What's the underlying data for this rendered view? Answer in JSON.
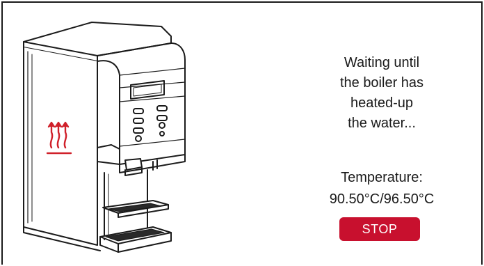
{
  "status": {
    "lines": [
      "Waiting until",
      "the boiler has",
      "heated-up",
      "the water..."
    ]
  },
  "temperature": {
    "label": "Temperature:",
    "current": "90.50°C",
    "target": "96.50°C",
    "display": "90.50°C/96.50°C"
  },
  "actions": {
    "stop_label": "STOP"
  },
  "colors": {
    "accent": "#c8102e",
    "line": "#1a1a1a",
    "heat_icon": "#d0202a"
  },
  "icons": {
    "heating": "heating-icon",
    "machine": "coffee-machine-illustration"
  }
}
